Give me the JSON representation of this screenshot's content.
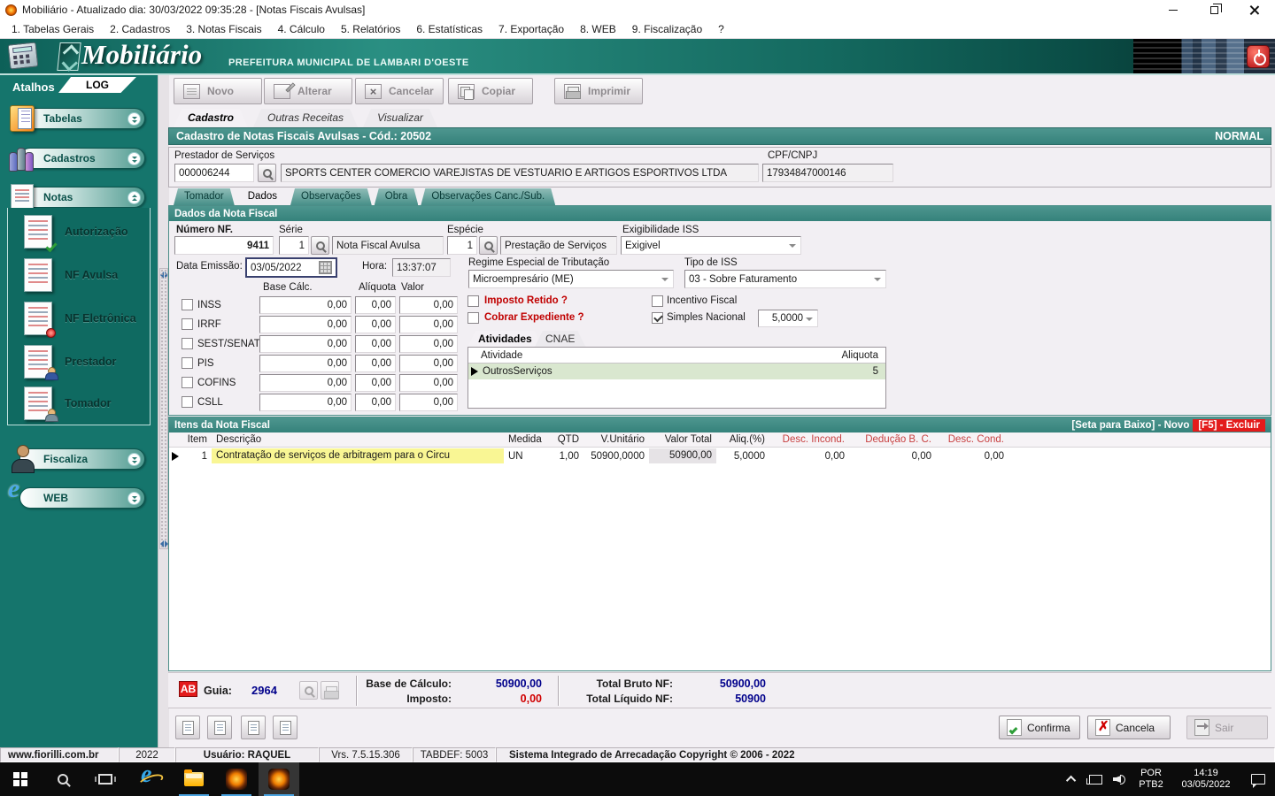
{
  "colors": {
    "teal_header": "#3f8b85",
    "sidebar_teal": "#15756c",
    "alert_red": "#c00000",
    "value_navy": "#00008b",
    "highlight_yellow": "#f9f694",
    "row_green": "#d9e7cf",
    "excluir_red": "#e31b1b",
    "taskbar_accent": "#4aa3e0"
  },
  "titlebar": {
    "title": "Mobiliário - Atualizado dia: 30/03/2022 09:35:28 - [Notas Fiscais Avulsas]"
  },
  "menubar": {
    "items": [
      "1. Tabelas Gerais",
      "2. Cadastros",
      "3. Notas Fiscais",
      "4. Cálculo",
      "5. Relatórios",
      "6. Estatísticas",
      "7. Exportação",
      "8. WEB",
      "9. Fiscalização",
      "?"
    ]
  },
  "banner": {
    "brand": "Mobiliário",
    "subtitle": "PREFEITURA MUNICIPAL DE LAMBARI D'OESTE"
  },
  "sidebar": {
    "atalhos": "Atalhos",
    "log": "LOG",
    "tabelas": "Tabelas",
    "cadastros": "Cadastros",
    "notas": "Notas",
    "notas_items": [
      "Autorização",
      "NF Avulsa",
      "NF Eletrônica",
      "Prestador",
      "Tomador"
    ],
    "fiscaliza": "Fiscaliza",
    "web": "WEB"
  },
  "toolbar": {
    "novo": "Novo",
    "alterar": "Alterar",
    "cancelar": "Cancelar",
    "copiar": "Copiar",
    "imprimir": "Imprimir"
  },
  "main_tabs": {
    "cadastro": "Cadastro",
    "outras": "Outras Receitas",
    "visualizar": "Visualizar"
  },
  "form_header": {
    "title": "Cadastro de Notas Fiscais Avulsas - Cód.: 20502",
    "status": "NORMAL"
  },
  "prestador": {
    "label": "Prestador de Serviços",
    "code": "000006244",
    "name": "SPORTS CENTER COMERCIO VAREJISTAS DE VESTUARIO E ARTIGOS ESPORTIVOS LTDA",
    "cpf_label": "CPF/CNPJ",
    "cpf": "17934847000146"
  },
  "detail_tabs": [
    "Tomador",
    "Dados",
    "Observações",
    "Obra",
    "Observações Canc./Sub."
  ],
  "dados": {
    "header": "Dados da Nota Fiscal",
    "numero_label": "Número NF.",
    "numero": "9411",
    "serie_label": "Série",
    "serie": "1",
    "serie_desc": "Nota Fiscal Avulsa",
    "especie_label": "Espécie",
    "especie": "1",
    "especie_desc": "Prestação de Serviços",
    "exig_label": "Exigibilidade ISS",
    "exig": "Exigivel",
    "data_label": "Data Emissão:",
    "data": "03/05/2022",
    "hora_label": "Hora:",
    "hora": "13:37:07",
    "regime_label": "Regime Especial de Tributação",
    "regime": "Microempresário (ME)",
    "tipo_iss_label": "Tipo de ISS",
    "tipo_iss": "03 - Sobre Faturamento",
    "col_base": "Base Cálc.",
    "col_aliq": "Alíquota",
    "col_valor": "Valor",
    "taxes": [
      {
        "label": "INSS",
        "base": "0,00",
        "aliq": "0,00",
        "valor": "0,00"
      },
      {
        "label": "IRRF",
        "base": "0,00",
        "aliq": "0,00",
        "valor": "0,00"
      },
      {
        "label": "SEST/SENAT",
        "base": "0,00",
        "aliq": "0,00",
        "valor": "0,00"
      },
      {
        "label": "PIS",
        "base": "0,00",
        "aliq": "0,00",
        "valor": "0,00"
      },
      {
        "label": "COFINS",
        "base": "0,00",
        "aliq": "0,00",
        "valor": "0,00"
      },
      {
        "label": "CSLL",
        "base": "0,00",
        "aliq": "0,00",
        "valor": "0,00"
      }
    ],
    "imposto_retido": "Imposto Retido ?",
    "cobrar_expediente": "Cobrar Expediente ?",
    "incentivo": "Incentivo Fiscal",
    "simples": "Simples Nacional",
    "simples_val": "5,0000",
    "ativ_tab": "Atividades",
    "cnae_tab": "CNAE",
    "ativ_col1": "Atividade",
    "ativ_col2": "Aliquota",
    "ativ_row": {
      "atividade": "OutrosServiços",
      "aliquota": "5"
    }
  },
  "itens": {
    "header": "Itens da Nota Fiscal",
    "hint_new": "[Seta para Baixo] - Novo",
    "hint_del": "[F5] - Excluir",
    "columns": [
      "Item",
      "Descrição",
      "Medida",
      "QTD",
      "V.Unitário",
      "Valor Total",
      "Aliq.(%)",
      "Desc. Incond.",
      "Dedução B. C.",
      "Desc. Cond."
    ],
    "row": {
      "item": "1",
      "descricao": "Contratação de serviços de arbitragem para o Circu",
      "medida": "UN",
      "qtd": "1,00",
      "v_unitario": "50900,0000",
      "valor_total": "50900,00",
      "aliq": "5,0000",
      "desc_incond": "0,00",
      "deducao": "0,00",
      "desc_cond": "0,00"
    }
  },
  "summary": {
    "ab": "AB",
    "guia_label": "Guia:",
    "guia": "2964",
    "base_label": "Base de Cálculo:",
    "base": "50900,00",
    "imposto_label": "Imposto:",
    "imposto": "0,00",
    "bruto_label": "Total Bruto NF:",
    "bruto": "50900,00",
    "liquido_label": "Total Líquido NF:",
    "liquido": "50900"
  },
  "actions": {
    "confirma": "Confirma",
    "cancela": "Cancela",
    "sair": "Sair"
  },
  "statusbar": {
    "site": "www.fiorilli.com.br",
    "year": "2022",
    "user": "Usuário: RAQUEL",
    "version": "Vrs. 7.5.15.306",
    "tabdef": "TABDEF: 5003",
    "copyright": "Sistema Integrado de Arrecadação Copyright © 2006 - 2022"
  },
  "taskbar": {
    "lang1": "POR",
    "lang2": "PTB2",
    "time": "14:19",
    "date": "03/05/2022"
  }
}
